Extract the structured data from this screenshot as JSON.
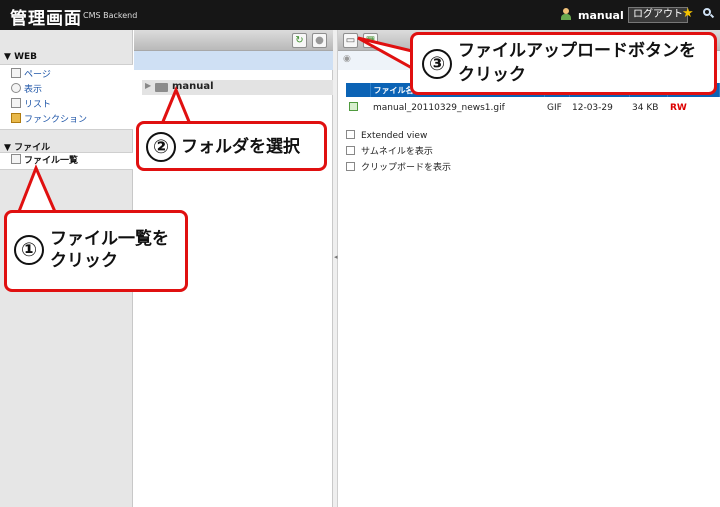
{
  "header": {
    "brand": "管理画面",
    "brand_sub": "CMS Backend",
    "username": "manual",
    "logout": "ログアウト"
  },
  "sidebar": {
    "sections": [
      {
        "title": "WEB",
        "items": [
          {
            "label": "ページ",
            "icon": "page-edit-icon"
          },
          {
            "label": "表示",
            "icon": "eye-icon"
          },
          {
            "label": "リスト",
            "icon": "list-icon"
          },
          {
            "label": "ファンクション",
            "icon": "wrench-icon"
          }
        ]
      },
      {
        "title": "ファイル",
        "items": [
          {
            "label": "ファイル一覧",
            "icon": "files-icon",
            "selected": true
          }
        ]
      }
    ]
  },
  "folders": {
    "items": [
      {
        "label": "manual",
        "icon": "drive-icon"
      }
    ]
  },
  "files": {
    "columns": [
      "ファイル名",
      "",
      "",
      "",
      ""
    ],
    "rows": [
      {
        "name": "manual_20110329_news1.gif",
        "type": "GIF",
        "date": "12-03-29",
        "size": "34 KB",
        "perm": "RW"
      }
    ],
    "options": [
      "Extended view",
      "サムネイルを表示",
      "クリップボードを表示"
    ]
  },
  "callouts": [
    {
      "num": "①",
      "line1": "ファイル一覧を",
      "line2": "クリック"
    },
    {
      "num": "②",
      "line1": "フォルダを選択"
    },
    {
      "num": "③",
      "line1": "ファイルアップロードボタンを",
      "line2": "クリック"
    }
  ],
  "colors": {
    "header_bg": "#161616",
    "callout_border": "#e01010",
    "table_header": "#0b63b5",
    "link": "#1f56a8",
    "permission": "#dd0000"
  }
}
